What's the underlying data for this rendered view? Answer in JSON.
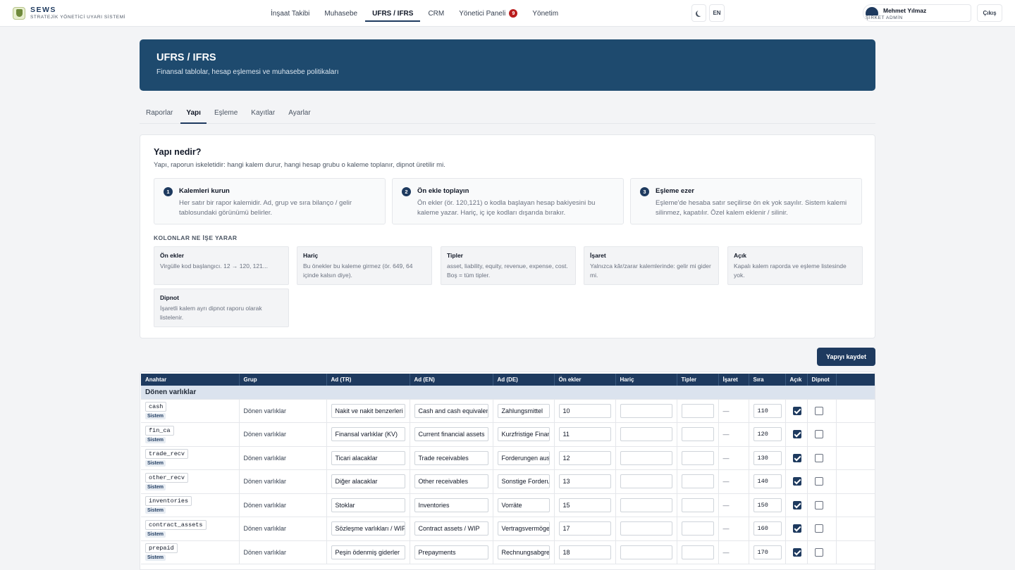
{
  "brand": {
    "name": "SEWS",
    "subtitle": "STRATEJİK YÖNETİCİ UYARI SİSTEMİ"
  },
  "nav": {
    "items": [
      {
        "label": "İnşaat Takibi"
      },
      {
        "label": "Muhasebe"
      },
      {
        "label": "UFRS / IFRS",
        "active": true
      },
      {
        "label": "CRM"
      },
      {
        "label": "Yönetici Paneli",
        "badge": "9"
      },
      {
        "label": "Yönetim"
      }
    ],
    "theme_icon": "moon-icon",
    "lang": "EN",
    "user_name": "Mehmet Yılmaz",
    "user_role": "ŞİRKET ADMİN",
    "logout": "Çıkış"
  },
  "header": {
    "title": "UFRS / IFRS",
    "subtitle": "Finansal tablolar, hesap eşlemesi ve muhasebe politikaları"
  },
  "tabs": [
    "Raporlar",
    "Yapı",
    "Eşleme",
    "Kayıtlar",
    "Ayarlar"
  ],
  "active_tab": "Yapı",
  "explain": {
    "title": "Yapı nedir?",
    "intro": "Yapı, raporun iskeletidir: hangi kalem durur, hangi hesap grubu o kaleme toplanır, dipnot üretilir mi.",
    "steps": [
      {
        "num": "1",
        "title": "Kalemleri kurun",
        "text": "Her satır bir rapor kalemidir. Ad, grup ve sıra bilanço / gelir tablosundaki görünümü belirler."
      },
      {
        "num": "2",
        "title": "Ön ekle toplayın",
        "text": "Ön ekler (ör. 120,121) o kodla başlayan hesap bakiyesini bu kaleme yazar. Hariç, iç içe kodları dışarıda bırakır."
      },
      {
        "num": "3",
        "title": "Eşleme ezer",
        "text": "Eşleme'de hesaba satır seçilirse ön ek yok sayılır. Sistem kalemi silinmez, kapatılır. Özel kalem eklenir / silinir."
      }
    ],
    "columns_heading": "KOLONLAR NE İŞE YARAR",
    "columns": [
      {
        "title": "Ön ekler",
        "text": "Virgülle kod başlangıcı. 12 → 120, 121..."
      },
      {
        "title": "Hariç",
        "text": "Bu önekler bu kaleme girmez (ör. 649, 64 içinde kalsın diye)."
      },
      {
        "title": "Tipler",
        "text": "asset, liability, equity, revenue, expense, cost. Boş = tüm tipler."
      },
      {
        "title": "İşaret",
        "text": "Yalnızca kâr/zarar kalemlerinde: gelir mi gider mi."
      },
      {
        "title": "Açık",
        "text": "Kapalı kalem raporda ve eşleme listesinde yok."
      },
      {
        "title": "Dipnot",
        "text": "İşaretli kalem ayrı dipnot raporu olarak listelenir."
      }
    ]
  },
  "save_button": "Yapıyı kaydet",
  "table": {
    "headers": [
      "Anahtar",
      "Grup",
      "Ad (TR)",
      "Ad (EN)",
      "Ad (DE)",
      "Ön ekler",
      "Hariç",
      "Tipler",
      "İşaret",
      "Sıra",
      "Açık",
      "Dipnot",
      ""
    ],
    "group_label": "Dönen varlıklar",
    "system_label": "Sistem",
    "sign_placeholder": "—",
    "rows": [
      {
        "key": "cash",
        "group": "Dönen varlıklar",
        "tr": "Nakit ve nakit benzerleri",
        "en": "Cash and cash equivalents",
        "de": "Zahlungsmittel",
        "prefix": "10",
        "exclude": "",
        "types": "",
        "order": "110",
        "open": true,
        "note": false
      },
      {
        "key": "fin_ca",
        "group": "Dönen varlıklar",
        "tr": "Finansal varlıklar (KV)",
        "en": "Current financial assets",
        "de": "Kurzfristige Finanzanlagen",
        "prefix": "11",
        "exclude": "",
        "types": "",
        "order": "120",
        "open": true,
        "note": false
      },
      {
        "key": "trade_recv",
        "group": "Dönen varlıklar",
        "tr": "Ticari alacaklar",
        "en": "Trade receivables",
        "de": "Forderungen aus L.u.L.",
        "prefix": "12",
        "exclude": "",
        "types": "",
        "order": "130",
        "open": true,
        "note": false
      },
      {
        "key": "other_recv",
        "group": "Dönen varlıklar",
        "tr": "Diğer alacaklar",
        "en": "Other receivables",
        "de": "Sonstige Forderungen",
        "prefix": "13",
        "exclude": "",
        "types": "",
        "order": "140",
        "open": true,
        "note": false
      },
      {
        "key": "inventories",
        "group": "Dönen varlıklar",
        "tr": "Stoklar",
        "en": "Inventories",
        "de": "Vorräte",
        "prefix": "15",
        "exclude": "",
        "types": "",
        "order": "150",
        "open": true,
        "note": false
      },
      {
        "key": "contract_assets",
        "group": "Dönen varlıklar",
        "tr": "Sözleşme varlıkları / WIP",
        "en": "Contract assets / WIP",
        "de": "Vertragsvermögenswerte",
        "prefix": "17",
        "exclude": "",
        "types": "",
        "order": "160",
        "open": true,
        "note": false
      },
      {
        "key": "prepaid",
        "group": "Dönen varlıklar",
        "tr": "Peşin ödenmiş giderler",
        "en": "Prepayments",
        "de": "Rechnungsabgrenzung",
        "prefix": "18",
        "exclude": "",
        "types": "",
        "order": "170",
        "open": true,
        "note": false
      }
    ]
  }
}
